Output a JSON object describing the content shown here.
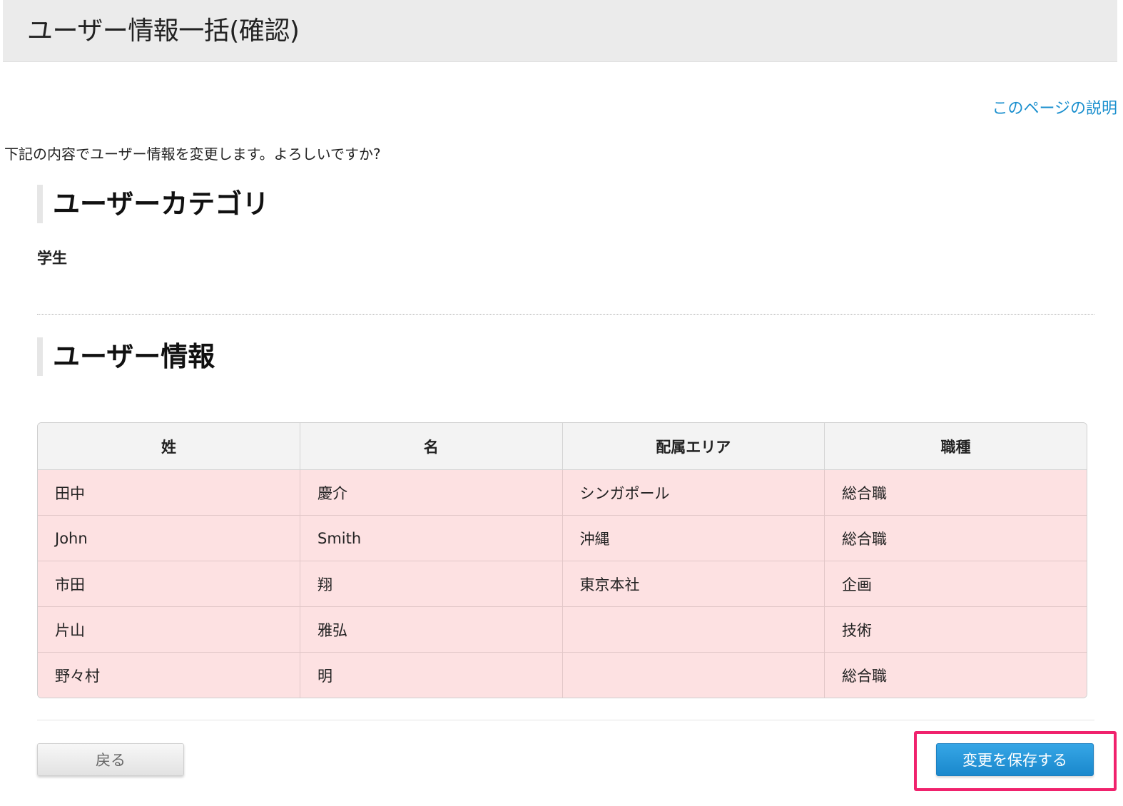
{
  "header": {
    "title": "ユーザー情報一括(確認)"
  },
  "help_link": "このページの説明",
  "confirm_message": "下記の内容でユーザー情報を変更します。よろしいですか?",
  "category_section": {
    "heading": "ユーザーカテゴリ",
    "value": "学生"
  },
  "userinfo_section": {
    "heading": "ユーザー情報",
    "columns": [
      "姓",
      "名",
      "配属エリア",
      "職種"
    ],
    "rows": [
      [
        "田中",
        "慶介",
        "シンガポール",
        "総合職"
      ],
      [
        "John",
        "Smith",
        "沖縄",
        "総合職"
      ],
      [
        "市田",
        "翔",
        "東京本社",
        "企画"
      ],
      [
        "片山",
        "雅弘",
        "",
        "技術"
      ],
      [
        "野々村",
        "明",
        "",
        "総合職"
      ]
    ]
  },
  "buttons": {
    "back": "戻る",
    "save": "変更を保存する"
  },
  "colors": {
    "accent": "#1a8fce",
    "row_highlight": "#fde1e2",
    "annotation_box": "#f0226d"
  }
}
